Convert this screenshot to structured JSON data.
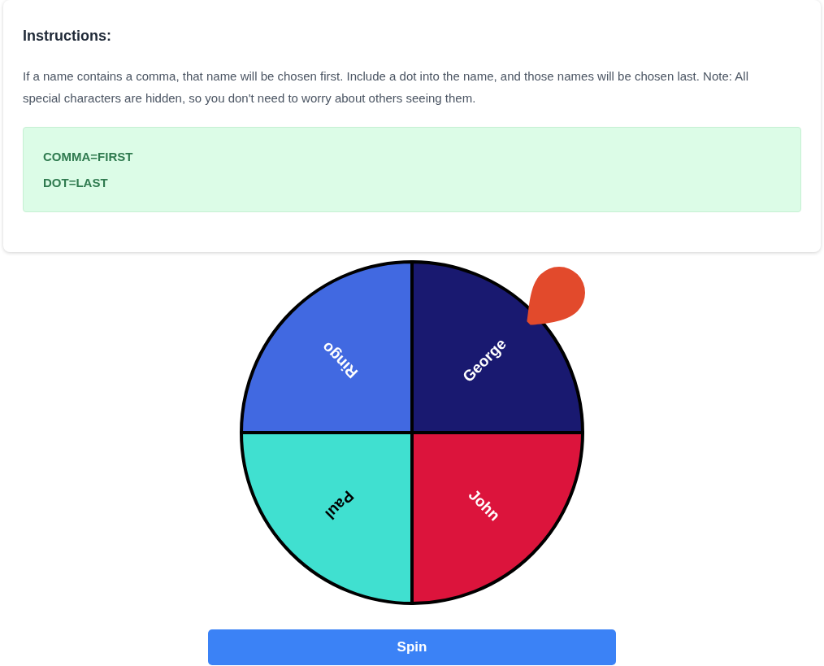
{
  "instructions": {
    "title": "Instructions:",
    "text": "If a name contains a comma, that name will be chosen first. Include a dot into the name, and those names will be chosen last. Note: All special characters are hidden, so you don't need to worry about others seeing them.",
    "rules": [
      "COMMA=FIRST",
      "DOT=LAST"
    ]
  },
  "wheel": {
    "segments": [
      {
        "label": "George",
        "color": "#191970"
      },
      {
        "label": "John",
        "color": "#dc143c"
      },
      {
        "label": "Paul",
        "color": "#40e0d0"
      },
      {
        "label": "Ringo",
        "color": "#4169e1"
      }
    ]
  },
  "spin_button": {
    "label": "Spin"
  }
}
